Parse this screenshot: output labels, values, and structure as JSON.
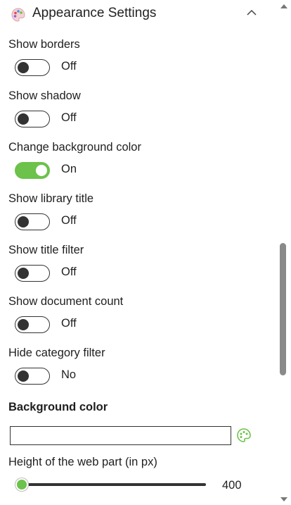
{
  "header": {
    "title": "Appearance Settings",
    "icon": "palette-icon",
    "collapse_icon": "chevron-up-icon"
  },
  "settings": [
    {
      "label": "Show borders",
      "on": false,
      "state": "Off"
    },
    {
      "label": "Show shadow",
      "on": false,
      "state": "Off"
    },
    {
      "label": "Change background color",
      "on": true,
      "state": "On"
    },
    {
      "label": "Show library title",
      "on": false,
      "state": "Off"
    },
    {
      "label": "Show title filter",
      "on": false,
      "state": "Off"
    },
    {
      "label": "Show document count",
      "on": false,
      "state": "Off"
    },
    {
      "label": "Hide category filter",
      "on": false,
      "state": "No"
    }
  ],
  "background_color": {
    "label": "Background color",
    "value": "",
    "picker_icon": "palette-icon"
  },
  "height": {
    "label": "Height of the web part (in px)",
    "value": "400",
    "slider_fraction": 0
  },
  "colors": {
    "accent": "#6cc24a",
    "toggle_off": "#333333",
    "text": "#1f1f1f"
  }
}
